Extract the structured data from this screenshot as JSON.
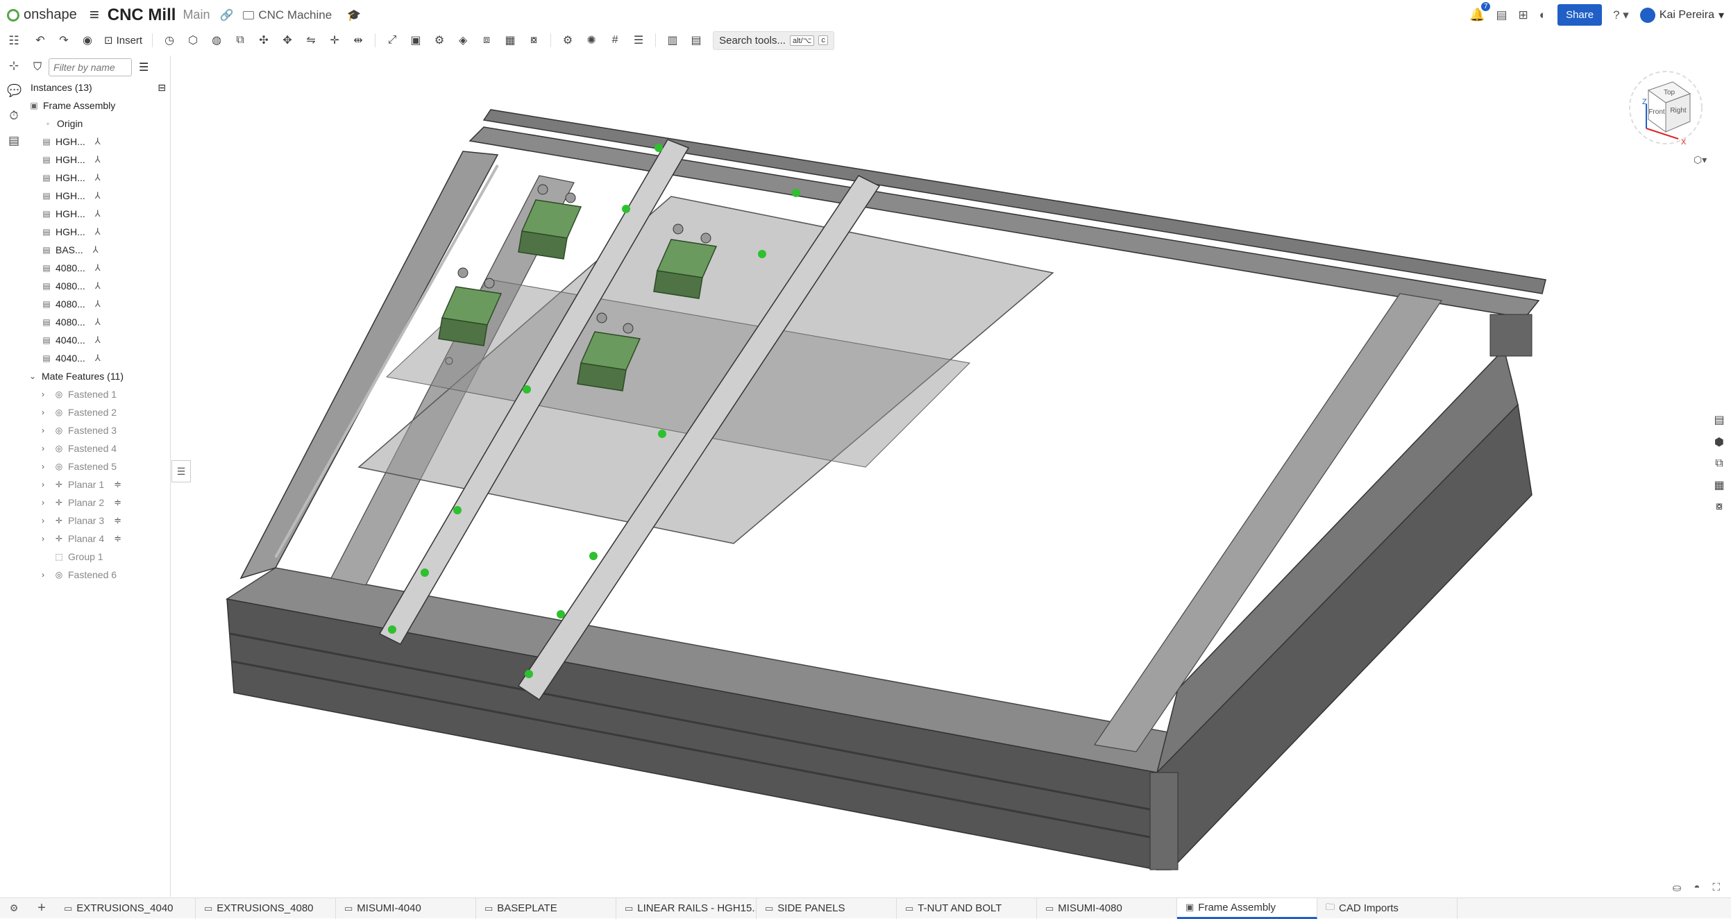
{
  "header": {
    "logo_text": "onshape",
    "title": "CNC Mill",
    "branch": "Main",
    "folder": "CNC Machine",
    "notifications": "7",
    "share_label": "Share",
    "user_name": "Kai Pereira"
  },
  "toolbar": {
    "insert_label": "Insert",
    "search_label": "Search tools...",
    "search_kbd": "alt/⌥",
    "search_key": "c"
  },
  "panel": {
    "filter_placeholder": "Filter by name",
    "instances_label": "Instances (13)",
    "assembly": "Frame Assembly",
    "origin": "Origin",
    "instances": [
      "HGH...",
      "HGH...",
      "HGH...",
      "HGH...",
      "HGH...",
      "HGH...",
      "BAS...",
      "4080...",
      "4080...",
      "4080...",
      "4080...",
      "4040...",
      "4040..."
    ],
    "mates_label": "Mate Features (11)",
    "mates": [
      "Fastened 1",
      "Fastened 2",
      "Fastened 3",
      "Fastened 4",
      "Fastened 5",
      "Planar 1",
      "Planar 2",
      "Planar 3",
      "Planar 4",
      "Group 1",
      "Fastened 6"
    ]
  },
  "viewcube": {
    "top": "Top",
    "front": "Front",
    "right": "Right",
    "z": "Z",
    "x": "X"
  },
  "tabs": [
    {
      "label": "EXTRUSIONS_4040",
      "icon": "part-studio-icon"
    },
    {
      "label": "EXTRUSIONS_4080",
      "icon": "part-studio-icon"
    },
    {
      "label": "MISUMI-4040",
      "icon": "part-studio-icon"
    },
    {
      "label": "BASEPLATE",
      "icon": "part-studio-icon"
    },
    {
      "label": "LINEAR RAILS - HGH15...",
      "icon": "part-studio-icon"
    },
    {
      "label": "SIDE PANELS",
      "icon": "part-studio-icon"
    },
    {
      "label": "T-NUT AND BOLT",
      "icon": "part-studio-icon"
    },
    {
      "label": "MISUMI-4080",
      "icon": "part-studio-icon"
    },
    {
      "label": "Frame Assembly",
      "icon": "assembly-icon"
    },
    {
      "label": "CAD Imports",
      "icon": "folder-icon"
    }
  ],
  "colors": {
    "accent": "#1f5fc6",
    "logo": "#57a64a",
    "rail": "#c9c9c9",
    "carriage": "#6b9a5e",
    "frame": "#8a8a8a"
  }
}
